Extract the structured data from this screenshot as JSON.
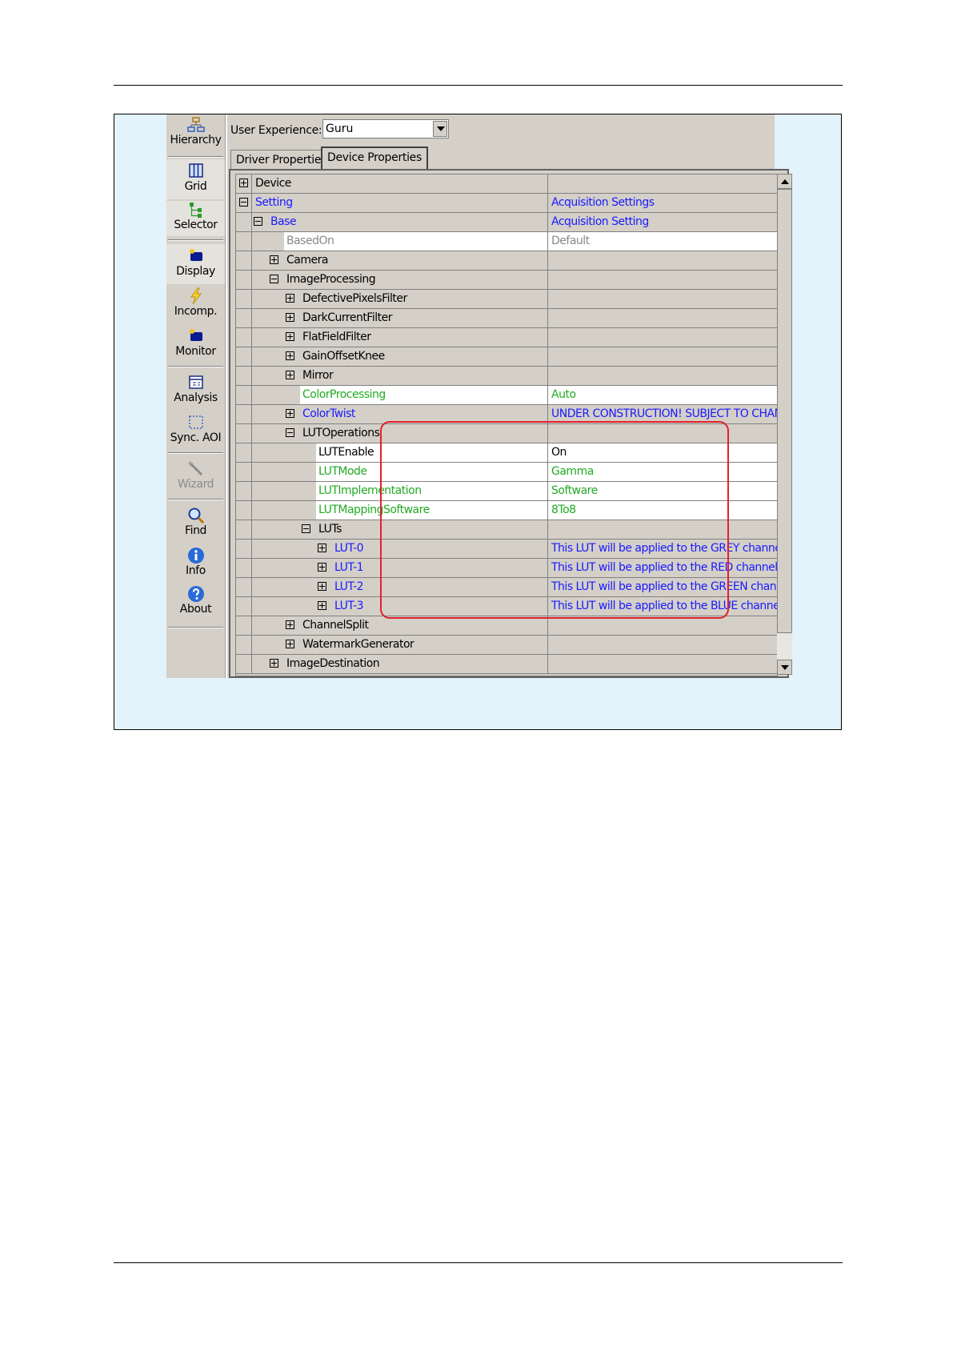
{
  "toolbar": {
    "items": [
      {
        "label": "Hierarchy",
        "icon": "hierarchy-icon"
      },
      {
        "label": "Grid",
        "icon": "grid-icon"
      },
      {
        "label": "Selector",
        "icon": "selector-icon"
      },
      {
        "label": "Display",
        "icon": "display-icon"
      },
      {
        "label": "Incomp.",
        "icon": "lightning-icon"
      },
      {
        "label": "Monitor",
        "icon": "monitor-icon"
      },
      {
        "label": "Analysis",
        "icon": "analysis-icon"
      },
      {
        "label": "Sync. AOI",
        "icon": "sync-aoi-icon"
      },
      {
        "label": "Wizard",
        "icon": "wand-icon"
      },
      {
        "label": "Find",
        "icon": "magnifier-icon"
      },
      {
        "label": "Info",
        "icon": "info-icon"
      },
      {
        "label": "About",
        "icon": "about-icon"
      }
    ]
  },
  "user_experience": {
    "label": "User Experience:",
    "selected": "Guru"
  },
  "tabs": [
    {
      "label": "Driver Properties",
      "active": false
    },
    {
      "label": "Device Properties",
      "active": true
    }
  ],
  "grid": {
    "rows": [
      {
        "name": "Device",
        "value": "",
        "expander": "plus",
        "color": "black"
      },
      {
        "name": "Setting",
        "value": "Acquisition Settings",
        "expander": "minus",
        "color": "blue"
      },
      {
        "name": "Base",
        "value": "Acquisition Setting",
        "expander": "minus",
        "color": "blue"
      },
      {
        "name": "BasedOn",
        "value": "Default",
        "expander": "",
        "color": "gray"
      },
      {
        "name": "Camera",
        "value": "",
        "expander": "plus",
        "color": "black"
      },
      {
        "name": "ImageProcessing",
        "value": "",
        "expander": "minus",
        "color": "black"
      },
      {
        "name": "DefectivePixelsFilter",
        "value": "",
        "expander": "plus",
        "color": "black"
      },
      {
        "name": "DarkCurrentFilter",
        "value": "",
        "expander": "plus",
        "color": "black"
      },
      {
        "name": "FlatFieldFilter",
        "value": "",
        "expander": "plus",
        "color": "black"
      },
      {
        "name": "GainOffsetKnee",
        "value": "",
        "expander": "plus",
        "color": "black"
      },
      {
        "name": "Mirror",
        "value": "",
        "expander": "plus",
        "color": "black"
      },
      {
        "name": "ColorProcessing",
        "value": "Auto",
        "expander": "",
        "color": "green"
      },
      {
        "name": "ColorTwist",
        "value": "UNDER CONSTRUCTION! SUBJECT TO CHANGE!!!",
        "expander": "plus",
        "color": "blue"
      },
      {
        "name": "LUTOperations",
        "value": "",
        "expander": "minus",
        "color": "black"
      },
      {
        "name": "LUTEnable",
        "value": "On",
        "expander": "",
        "color": "black"
      },
      {
        "name": "LUTMode",
        "value": "Gamma",
        "expander": "",
        "color": "green"
      },
      {
        "name": "LUTImplementation",
        "value": "Software",
        "expander": "",
        "color": "green"
      },
      {
        "name": "LUTMappingSoftware",
        "value": "8To8",
        "expander": "",
        "color": "green"
      },
      {
        "name": "LUTs",
        "value": "",
        "expander": "minus",
        "color": "black"
      },
      {
        "name": "LUT-0",
        "value": "This LUT will be applied to the GREY channel for MO",
        "expander": "plus",
        "color": "blue"
      },
      {
        "name": "LUT-1",
        "value": "This LUT will be applied to the RED channel for RGB",
        "expander": "plus",
        "color": "blue"
      },
      {
        "name": "LUT-2",
        "value": "This LUT will be applied to the GREEN channel for R",
        "expander": "plus",
        "color": "blue"
      },
      {
        "name": "LUT-3",
        "value": "This LUT will be applied to the BLUE channel for RG",
        "expander": "plus",
        "color": "blue"
      },
      {
        "name": "ChannelSplit",
        "value": "",
        "expander": "plus",
        "color": "black"
      },
      {
        "name": "WatermarkGenerator",
        "value": "",
        "expander": "plus",
        "color": "black"
      },
      {
        "name": "ImageDestination",
        "value": "",
        "expander": "plus",
        "color": "black"
      }
    ]
  },
  "colors": {
    "highlight": "#e3202a",
    "link_blue": "#1a1aff",
    "modified_green": "#22aa22",
    "figure_bg": "#e3f2fb"
  }
}
